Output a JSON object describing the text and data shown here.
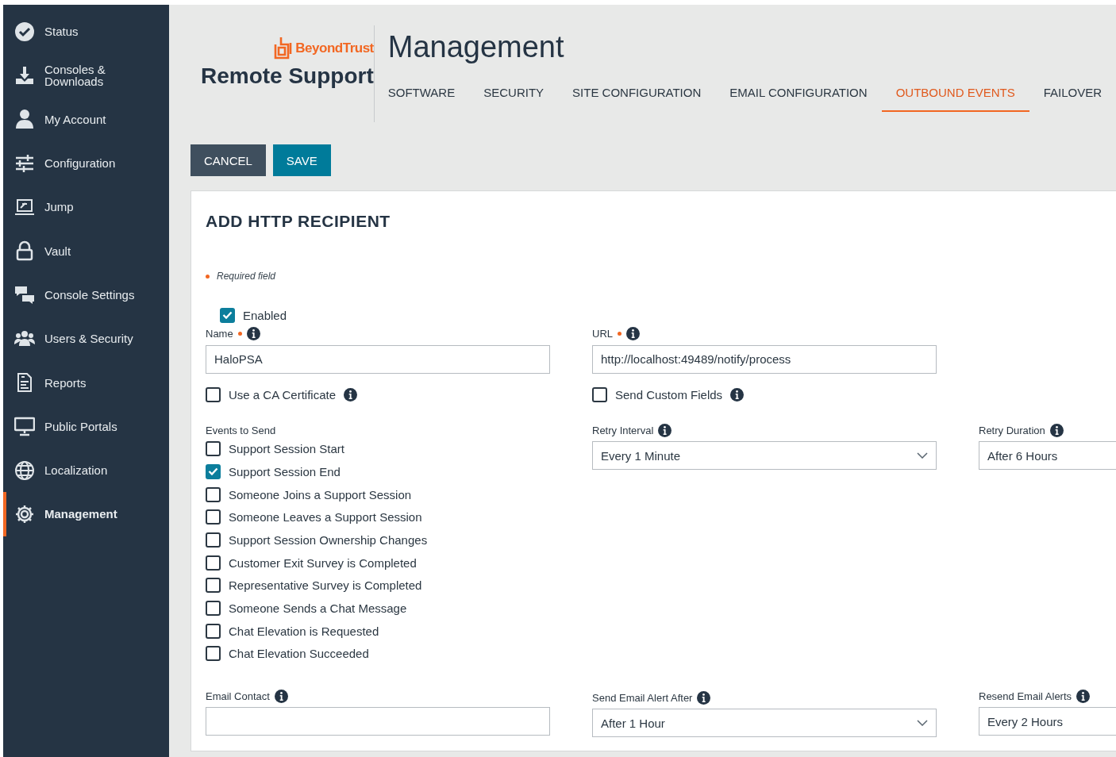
{
  "sidebar": {
    "items": [
      {
        "label": "Status",
        "selected": false
      },
      {
        "label": "Consoles & Downloads",
        "selected": false
      },
      {
        "label": "My Account",
        "selected": false
      },
      {
        "label": "Configuration",
        "selected": false
      },
      {
        "label": "Jump",
        "selected": false
      },
      {
        "label": "Vault",
        "selected": false
      },
      {
        "label": "Console Settings",
        "selected": false
      },
      {
        "label": "Users & Security",
        "selected": false
      },
      {
        "label": "Reports",
        "selected": false
      },
      {
        "label": "Public Portals",
        "selected": false
      },
      {
        "label": "Localization",
        "selected": false
      },
      {
        "label": "Management",
        "selected": true
      }
    ]
  },
  "header": {
    "brand": "BeyondTrust",
    "product": "Remote Support",
    "title": "Management",
    "tabs": [
      {
        "label": "SOFTWARE",
        "selected": false
      },
      {
        "label": "SECURITY",
        "selected": false
      },
      {
        "label": "SITE CONFIGURATION",
        "selected": false
      },
      {
        "label": "EMAIL CONFIGURATION",
        "selected": false
      },
      {
        "label": "OUTBOUND EVENTS",
        "selected": true
      },
      {
        "label": "FAILOVER",
        "selected": false
      }
    ]
  },
  "actions": [
    "CANCEL",
    "SAVE"
  ],
  "form": {
    "title": "ADD HTTP RECIPIENT",
    "required_note": "Required field",
    "enabled": {
      "label": "Enabled",
      "checked": true
    },
    "name": {
      "label": "Name",
      "required": true,
      "value": "HaloPSA"
    },
    "url": {
      "label": "URL",
      "required": true,
      "value": "http://localhost:49489/notify/process"
    },
    "ca_certificate": {
      "label": "Use a CA Certificate",
      "checked": false
    },
    "custom_fields": {
      "label": "Send Custom Fields",
      "checked": false
    },
    "events": {
      "label": "Events to Send",
      "items": [
        {
          "label": "Support Session Start",
          "checked": false
        },
        {
          "label": "Support Session End",
          "checked": true
        },
        {
          "label": "Someone Joins a Support Session",
          "checked": false
        },
        {
          "label": "Someone Leaves a Support Session",
          "checked": false
        },
        {
          "label": "Support Session Ownership Changes",
          "checked": false
        },
        {
          "label": "Customer Exit Survey is Completed",
          "checked": false
        },
        {
          "label": "Representative Survey is Completed",
          "checked": false
        },
        {
          "label": "Someone Sends a Chat Message",
          "checked": false
        },
        {
          "label": "Chat Elevation is Requested",
          "checked": false
        },
        {
          "label": "Chat Elevation Succeeded",
          "checked": false
        }
      ]
    },
    "retry_interval": {
      "label": "Retry Interval",
      "value": "Every 1 Minute"
    },
    "retry_duration": {
      "label": "Retry Duration",
      "value": "After 6 Hours"
    },
    "email_contact": {
      "label": "Email Contact"
    },
    "email_alert_after": {
      "label": "Send Email Alert After",
      "value": "After 1 Hour"
    },
    "resend_email_alerts": {
      "label": "Resend Email Alerts",
      "value": "Every 2 Hours"
    }
  }
}
